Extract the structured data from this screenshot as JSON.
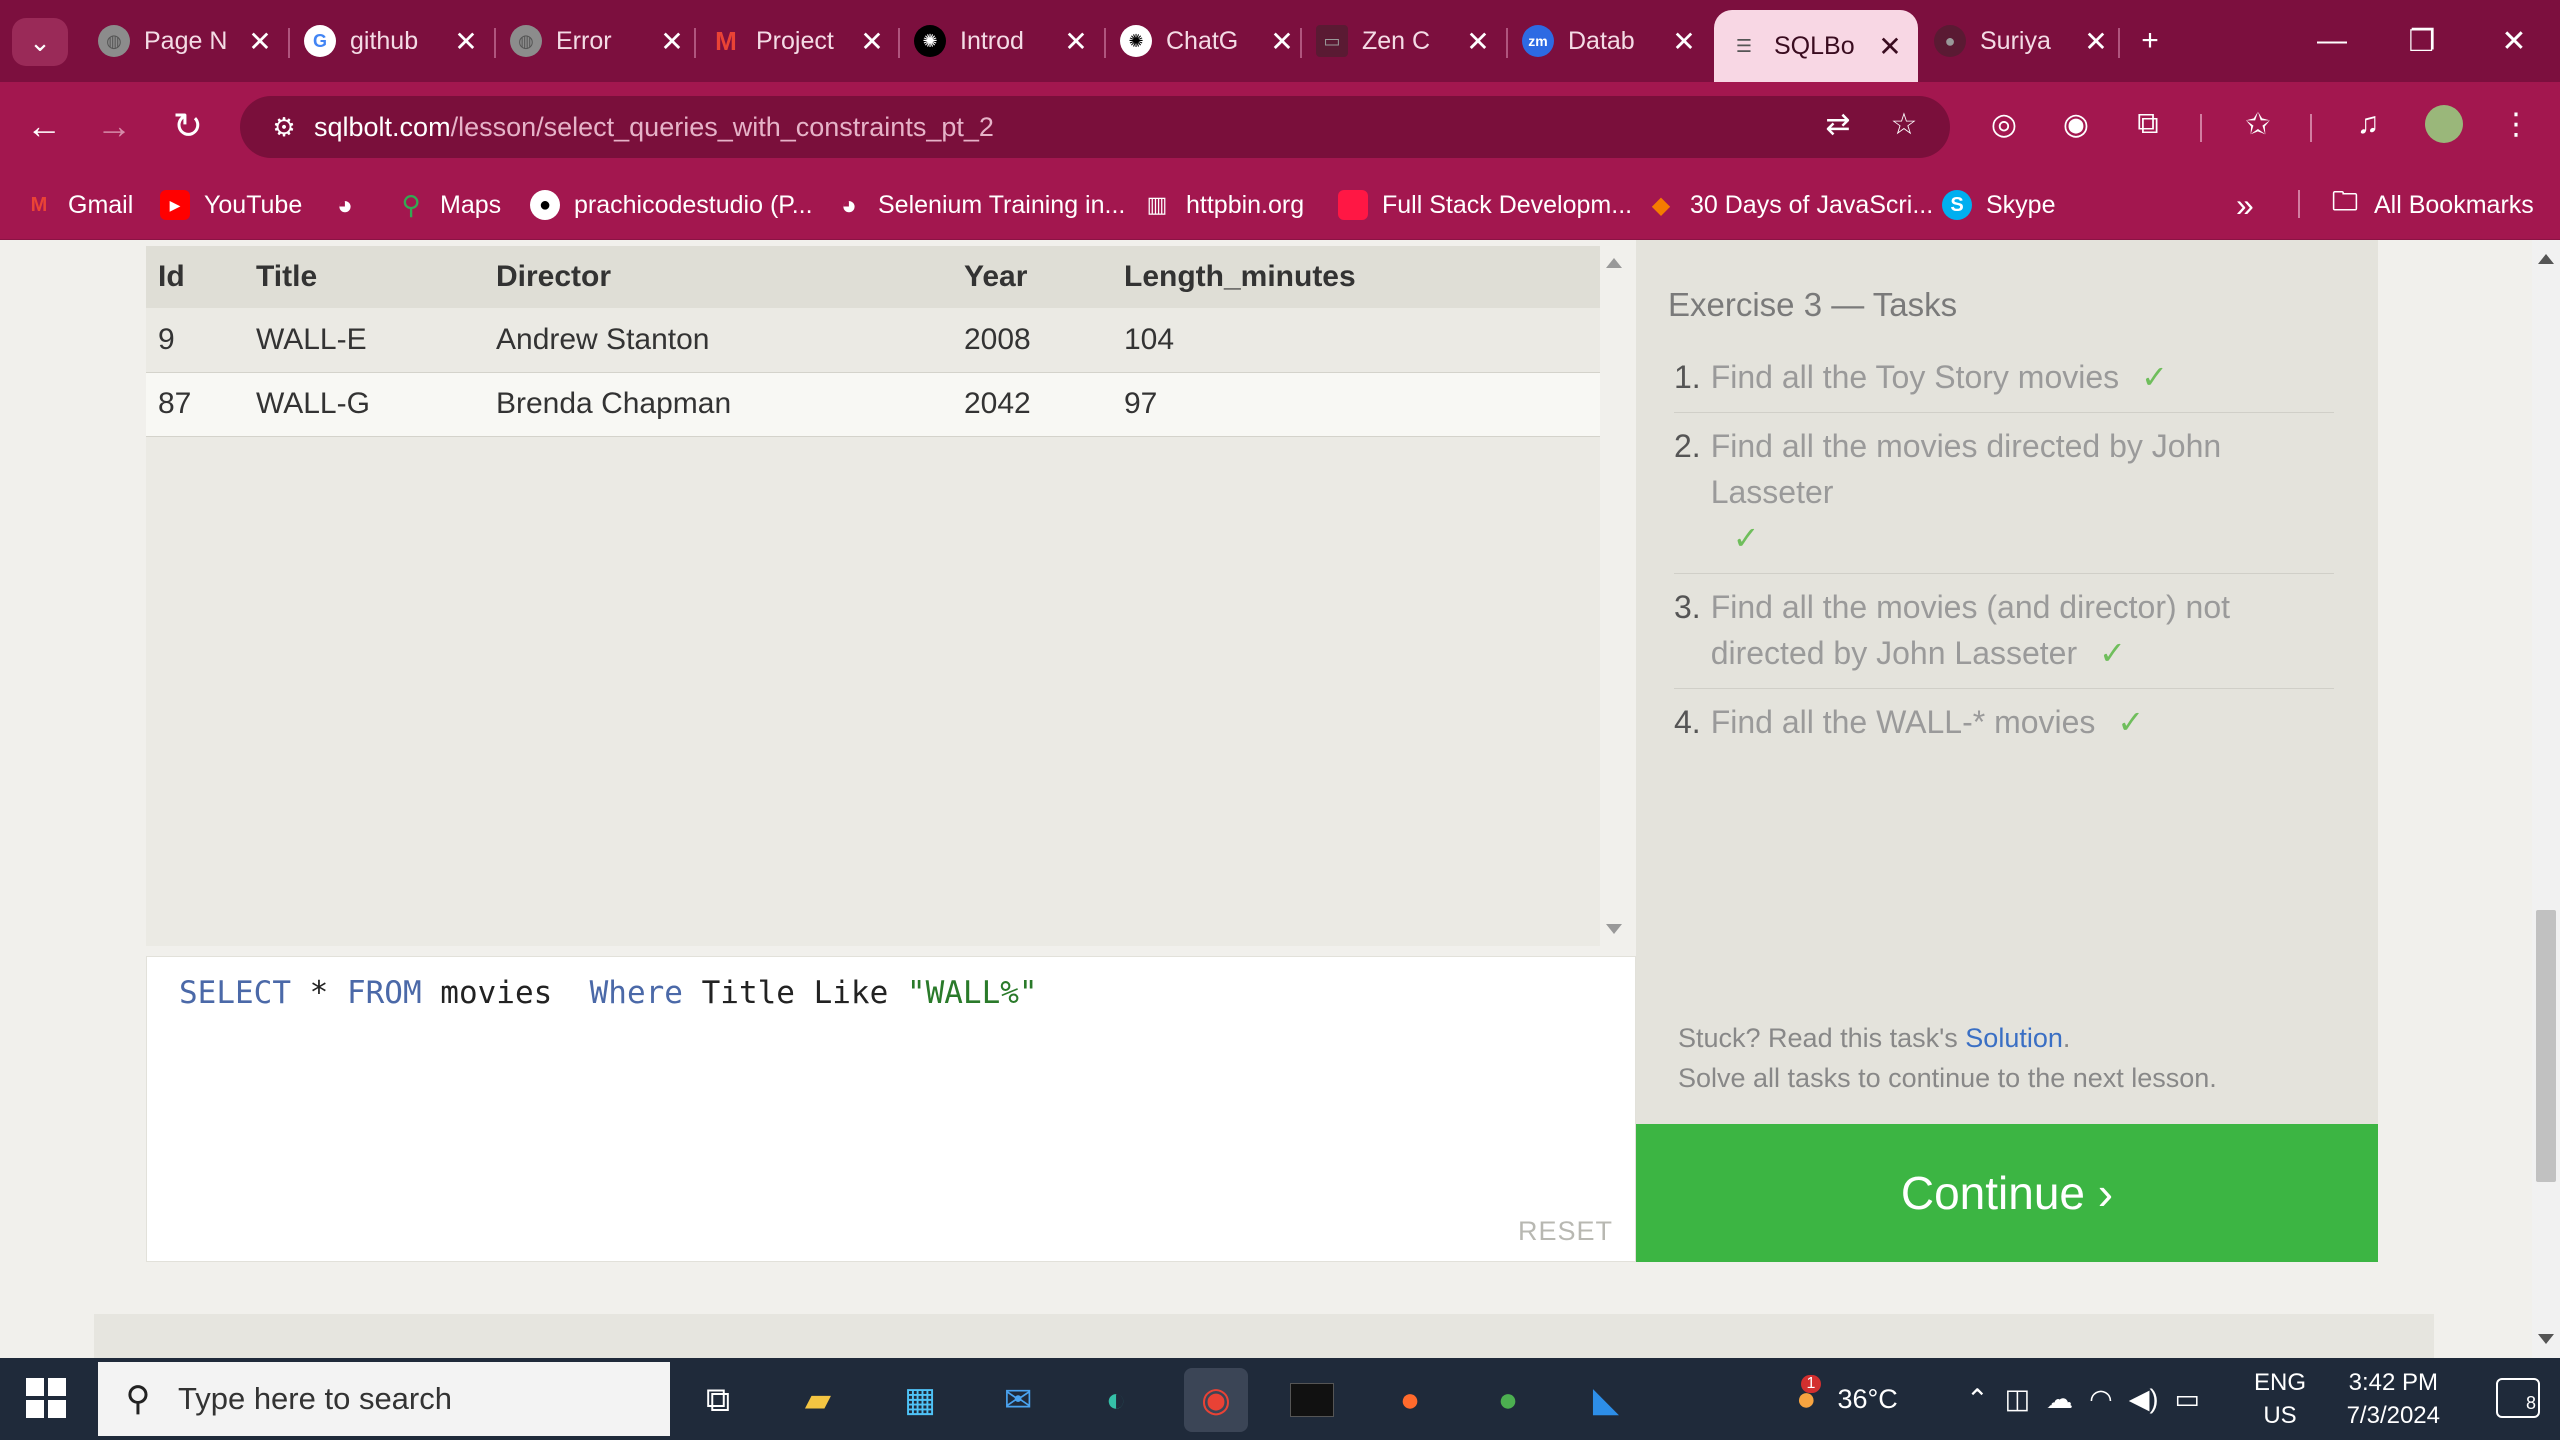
{
  "browser": {
    "tabs": [
      {
        "title": "Page N",
        "icon": "globe-icon",
        "active": false
      },
      {
        "title": "github",
        "icon": "google-icon",
        "active": false
      },
      {
        "title": "Error",
        "icon": "globe-icon",
        "active": false
      },
      {
        "title": "Project",
        "icon": "gmail-icon",
        "active": false
      },
      {
        "title": "Introd",
        "icon": "chatgpt-icon",
        "active": false
      },
      {
        "title": "ChatG",
        "icon": "chatgpt-icon",
        "active": false
      },
      {
        "title": "Zen C",
        "icon": "page-icon",
        "active": false
      },
      {
        "title": "Datab",
        "icon": "zoom-icon",
        "active": false
      },
      {
        "title": "SQLBo",
        "icon": "database-icon",
        "active": true
      },
      {
        "title": "Suriya",
        "icon": "github-icon",
        "active": false
      }
    ],
    "new_tab_label": "+",
    "url_host": "sqlbolt.com",
    "url_path": "/lesson/select_queries_with_constraints_pt_2",
    "bookmarks": [
      {
        "label": "Gmail",
        "icon": "gmail-icon"
      },
      {
        "label": "YouTube",
        "icon": "youtube-icon"
      },
      {
        "label": "",
        "icon": "globe-icon"
      },
      {
        "label": "Maps",
        "icon": "maps-icon"
      },
      {
        "label": "prachicodestudio (P...",
        "icon": "github-icon"
      },
      {
        "label": "Selenium Training in...",
        "icon": "globe-icon"
      },
      {
        "label": "httpbin.org",
        "icon": "httpbin-icon"
      },
      {
        "label": "Full Stack Developm...",
        "icon": "bookmark-icon"
      },
      {
        "label": "30 Days of JavaScri...",
        "icon": "js-icon"
      },
      {
        "label": "Skype",
        "icon": "skype-icon"
      }
    ],
    "more_bookmarks": "»",
    "all_bookmarks": "All Bookmarks"
  },
  "results": {
    "columns": [
      "Id",
      "Title",
      "Director",
      "Year",
      "Length_minutes"
    ],
    "rows": [
      [
        "9",
        "WALL-E",
        "Andrew Stanton",
        "2008",
        "104"
      ],
      [
        "87",
        "WALL-G",
        "Brenda Chapman",
        "2042",
        "97"
      ]
    ]
  },
  "editor": {
    "query_parts": [
      {
        "text": "SELECT",
        "kind": "kw"
      },
      {
        "text": " * ",
        "kind": "plain"
      },
      {
        "text": "FROM",
        "kind": "kw"
      },
      {
        "text": " movies  ",
        "kind": "plain"
      },
      {
        "text": "Where",
        "kind": "kw"
      },
      {
        "text": " Title Like ",
        "kind": "plain"
      },
      {
        "text": "\"WALL%\"",
        "kind": "str"
      }
    ],
    "reset_label": "RESET"
  },
  "tasks": {
    "heading": "Exercise 3 — Tasks",
    "items": [
      {
        "num": "1.",
        "text": "Find all the Toy Story movies",
        "check": "✓"
      },
      {
        "num": "2.",
        "text": "Find all the movies directed by John Lasseter",
        "check": "✓"
      },
      {
        "num": "3.",
        "text": "Find all the movies (and director) not directed by John Lasseter",
        "check": "✓"
      },
      {
        "num": "4.",
        "text": "Find all the WALL-* movies",
        "check": "✓"
      }
    ],
    "stuck_prefix": "Stuck? Read this task's ",
    "solution_link": "Solution",
    "stuck_suffix": ".",
    "solve_all": "Solve all tasks to continue to the next lesson."
  },
  "continue_label": "Continue ›",
  "taskbar": {
    "search_placeholder": "Type here to search",
    "weather_temp": "36°C",
    "weather_badge": "1",
    "lang_top": "ENG",
    "lang_bottom": "US",
    "time": "3:42 PM",
    "date": "7/3/2024",
    "notification_count": "8"
  },
  "colors": {
    "tab_strip": "#7c0f3e",
    "toolbar": "#a3174f",
    "continue": "#3cb543",
    "check": "#6fbe5c",
    "link": "#3a6fc4"
  }
}
